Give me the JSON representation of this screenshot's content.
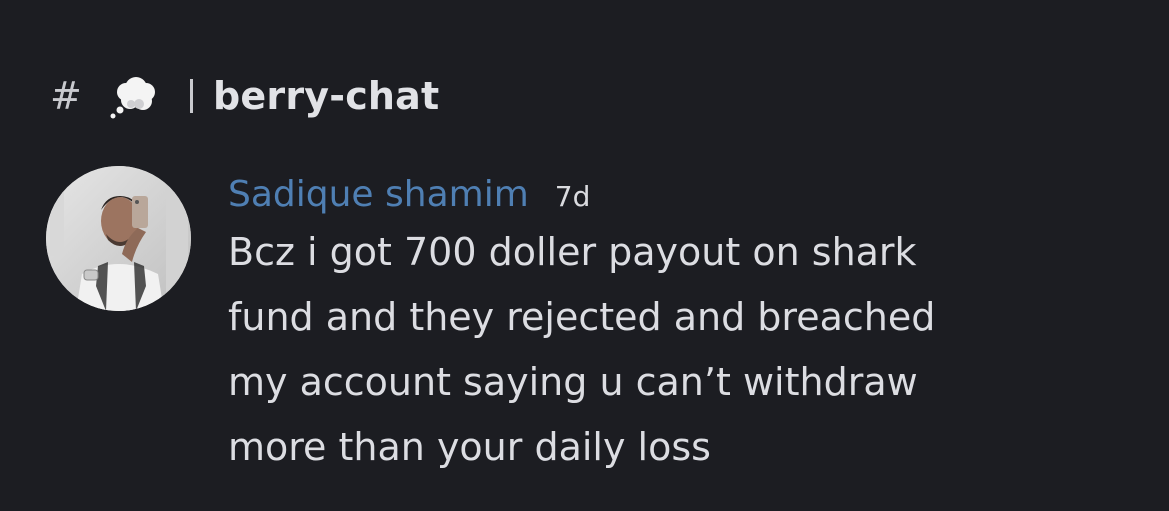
{
  "channel": {
    "hash_symbol": "#",
    "emoji_icon": "thought-balloon-icon",
    "name": "berry-chat"
  },
  "message": {
    "author": "Sadique shamim",
    "author_color": "#4f7fb3",
    "timestamp": "7d",
    "avatar": "user-avatar-photo",
    "text": "Bcz i got 700 doller payout on shark\nfund and they rejected and breached\nmy account saying u can’t withdraw\nmore than your daily loss"
  },
  "colors": {
    "background": "#1c1d22",
    "text": "#dcdde2"
  }
}
